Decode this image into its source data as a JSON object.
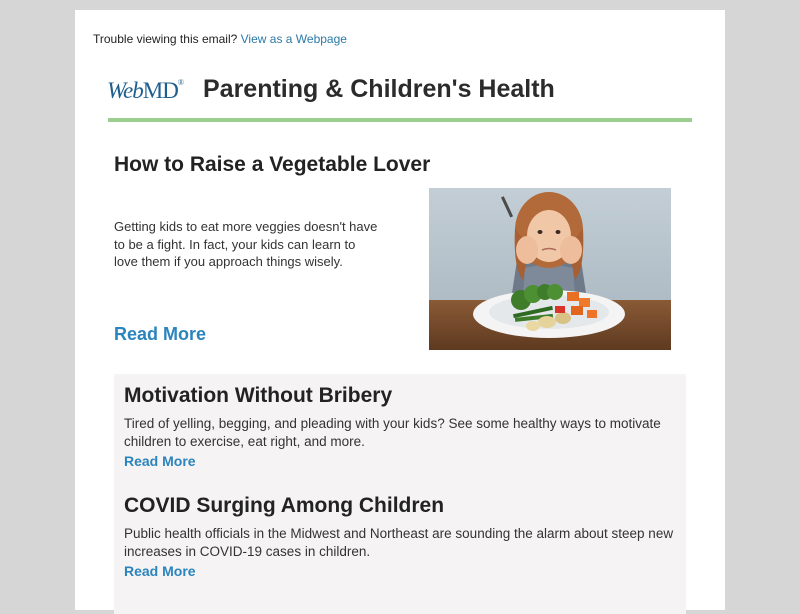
{
  "preheader": {
    "text": "Trouble viewing this email?",
    "link": "View as a Webpage"
  },
  "header": {
    "logo_web": "Web",
    "logo_md": "MD",
    "logo_reg": "®",
    "title": "Parenting & Children's Health",
    "rule_color": "#9ccf8f"
  },
  "hero": {
    "title": "How to Raise a Vegetable Lover",
    "body": "Getting kids to eat more veggies doesn't have to be a fight. In fact, your kids can learn to love them if you approach things wisely.",
    "read_more": "Read More",
    "image": "child-with-vegetable-plate"
  },
  "articles": [
    {
      "title": "Motivation Without Bribery",
      "body": "Tired of yelling, begging, and pleading with your kids? See some healthy ways to motivate children to exercise, eat right, and more.",
      "read_more": "Read More"
    },
    {
      "title": "COVID Surging Among Children",
      "body": "Public health officials in the Midwest and Northeast are sounding the alarm about steep new increases in COVID-19 cases in children.",
      "read_more": "Read More"
    }
  ],
  "colors": {
    "link": "#2a84bd",
    "background": "#d6d6d6",
    "card": "#f5f3f3"
  }
}
